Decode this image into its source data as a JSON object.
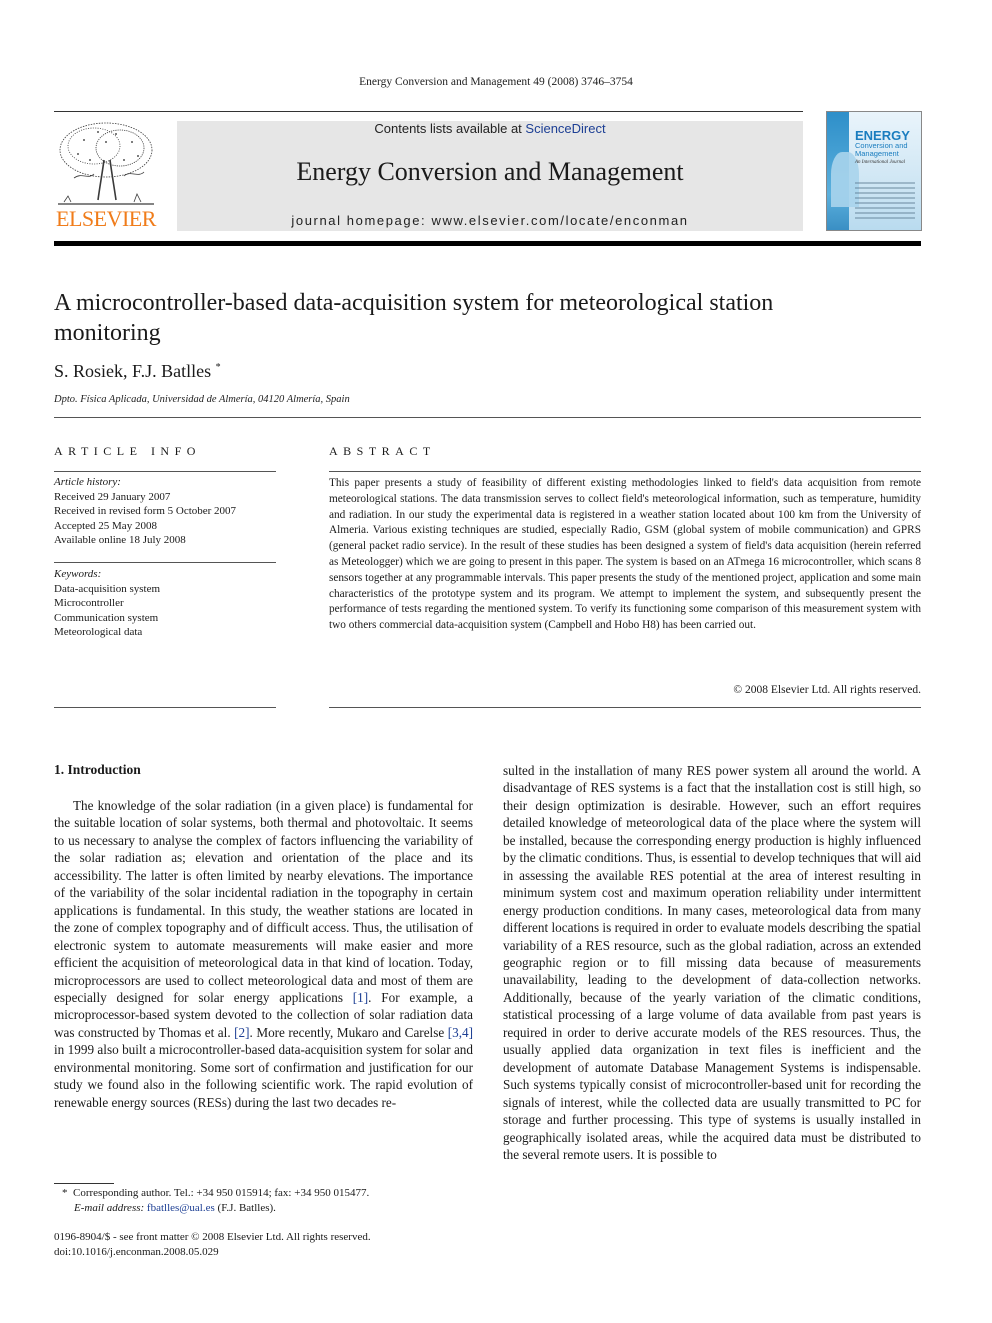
{
  "header": {
    "running_head": "Energy Conversion and Management 49 (2008) 3746–3754",
    "publisher_logo_text": "ELSEVIER",
    "contents_prefix": "Contents lists available at ",
    "contents_link": "ScienceDirect",
    "journal_title": "Energy Conversion and Management",
    "homepage": "journal homepage: www.elsevier.com/locate/enconman",
    "cover": {
      "title": "ENERGY",
      "subtitle": "Conversion and Management",
      "tagline": "An International Journal"
    }
  },
  "article": {
    "title": "A microcontroller-based data-acquisition system for meteorological station monitoring",
    "authors": "S. Rosiek, F.J. Batlles",
    "author_mark": "*",
    "affiliation": "Dpto. Física Aplicada, Universidad de Almería, 04120 Almería, Spain"
  },
  "article_info": {
    "heading": "ARTICLE INFO",
    "history_label": "Article history:",
    "history": [
      "Received 29 January 2007",
      "Received in revised form 5 October 2007",
      "Accepted 25 May 2008",
      "Available online 18 July 2008"
    ],
    "keywords_label": "Keywords:",
    "keywords": [
      "Data-acquisition system",
      "Microcontroller",
      "Communication system",
      "Meteorological data"
    ]
  },
  "abstract": {
    "heading": "ABSTRACT",
    "text": "This paper presents a study of feasibility of different existing methodologies linked to field's data acquisition from remote meteorological stations. The data transmission serves to collect field's meteorological information, such as temperature, humidity and radiation. In our study the experimental data is registered in a weather station located about 100 km from the University of Almeria. Various existing techniques are studied, especially Radio, GSM (global system of mobile communication) and GPRS (general packet radio service). In the result of these studies has been designed a system of field's data acquisition (herein referred as Meteologger) which we are going to present in this paper. The system is based on an ATmega 16 microcontroller, which scans 8 sensors together at any programmable intervals. This paper presents the study of the mentioned project, application and some main characteristics of the prototype system and its program. We attempt to implement the system, and subsequently present the performance of tests regarding the mentioned system. To verify its functioning some comparison of this measurement system with two others commercial data-acquisition system (Campbell and Hobo H8) has been carried out.",
    "copyright": "© 2008 Elsevier Ltd. All rights reserved."
  },
  "body": {
    "section_heading": "1. Introduction",
    "left_col": {
      "p1": "The knowledge of the solar radiation (in a given place) is fundamental for the suitable location of solar systems, both thermal and photovoltaic. It seems to us necessary to analyse the complex of factors influencing the variability of the solar radiation as; elevation and orientation of the place and its accessibility. The latter is often limited by nearby elevations. The importance of the variability of the solar incidental radiation in the topography in certain applications is fundamental. In this study, the weather stations are located in the zone of complex topography and of difficult access. Thus, the utilisation of electronic system to automate measurements will make easier and more efficient the acquisition of meteorological data in that kind of location. Today, microprocessors are used to collect meteorological data and most of them are especially designed for solar energy applications ",
      "ref1": "[1]",
      "p2": ". For example, a microprocessor-based system devoted to the collection of solar radiation data was constructed by Thomas et al. ",
      "ref2": "[2]",
      "p3": ". More recently, Mukaro and Carelse ",
      "ref3": "[3,4]",
      "p4": " in 1999 also built a microcontroller-based data-acquisition system for solar and environmental monitoring. Some sort of confirmation and justification for our study we found also in the following scientific work. The rapid evolution of renewable energy sources (RESs) during the last two decades re-"
    },
    "right_col": {
      "text": "sulted in the installation of many RES power system all around the world. A disadvantage of RES systems is a fact that the installation cost is still high, so their design optimization is desirable. However, such an effort requires detailed knowledge of meteorological data of the place where the system will be installed, because the corresponding energy production is highly influenced by the climatic conditions. Thus, is essential to develop techniques that will aid in assessing the available RES potential at the area of interest resulting in minimum system cost and maximum operation reliability under intermittent energy production conditions. In many cases, meteorological data from many different locations is required in order to evaluate models describing the spatial variability of a RES resource, such as the global radiation, across an extended geographic region or to fill missing data because of measurements unavailability, leading to the development of data-collection networks. Additionally, because of the yearly variation of the climatic conditions, statistical processing of a large volume of data available from past years is required in order to derive accurate models of the RES resources. Thus, the usually applied data organization in text files is inefficient and the development of automate Database Management Systems is indispensable. Such systems typically consist of microcontroller-based unit for recording the signals of interest, while the collected data are usually transmitted to PC for storage and further processing. This type of systems is usually installed in geographically isolated areas, while the acquired data must be distributed to the several remote users. It is possible to"
    }
  },
  "footnote": {
    "mark": "*",
    "corresponding": "Corresponding author. Tel.: +34 950 015914; fax: +34 950 015477.",
    "email_label": "E-mail address:",
    "email": "fbatlles@ual.es",
    "email_suffix": " (F.J. Batlles)."
  },
  "footer": {
    "issn": "0196-8904/$ - see front matter © 2008 Elsevier Ltd. All rights reserved.",
    "doi": "doi:10.1016/j.enconman.2008.05.029"
  }
}
